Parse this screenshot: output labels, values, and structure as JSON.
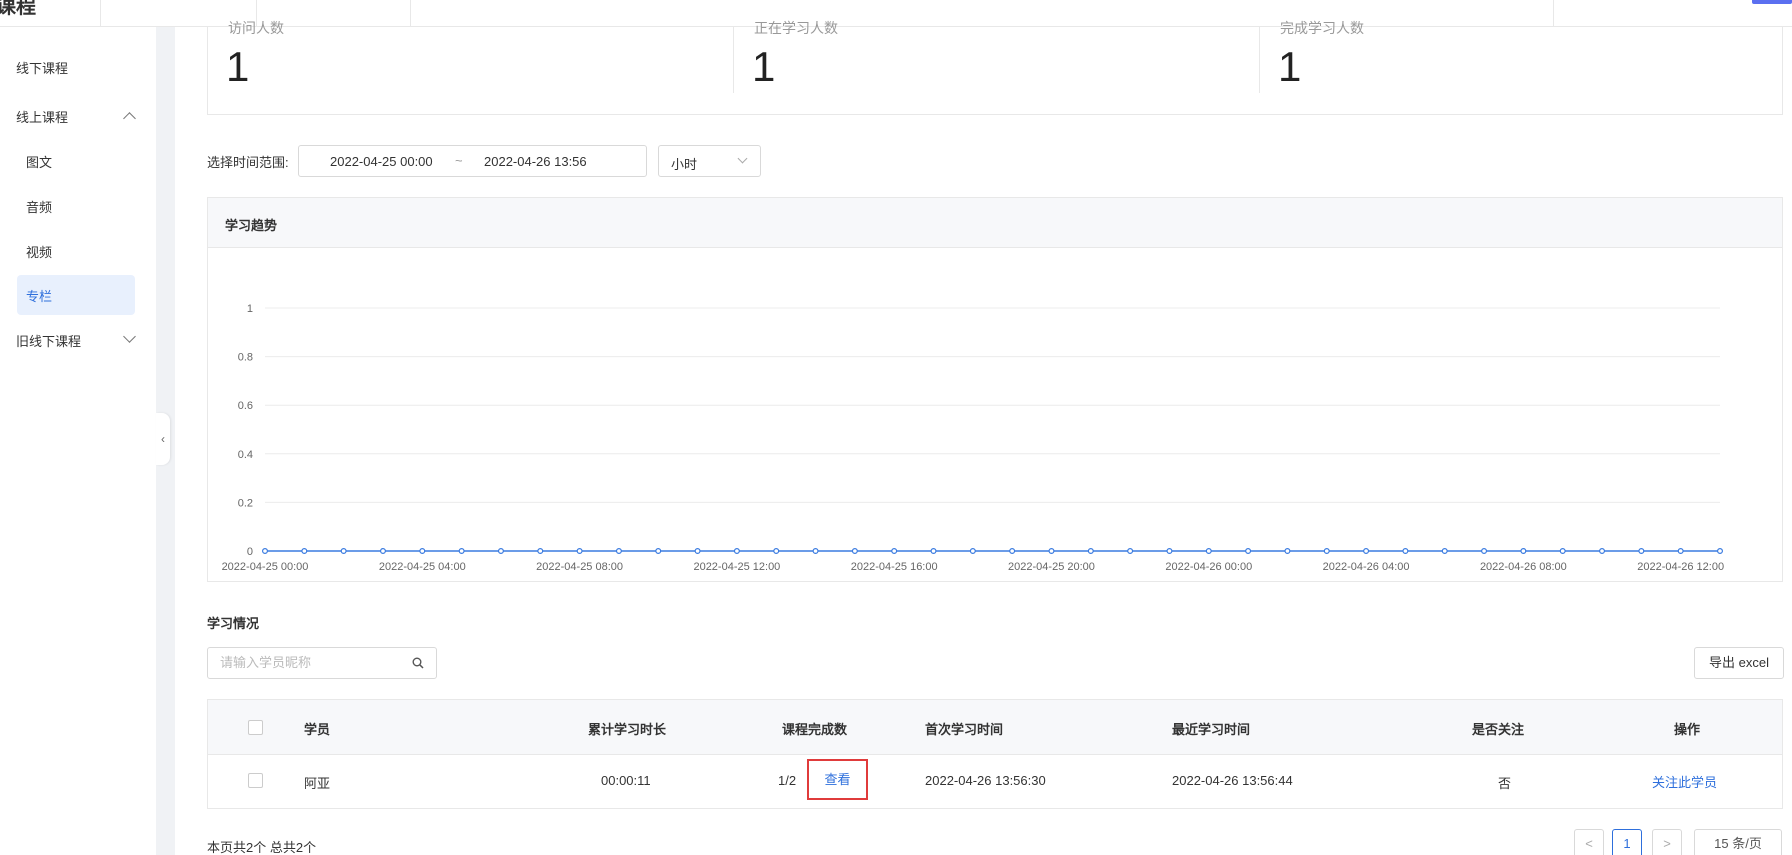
{
  "header": {
    "brand": "课程 "
  },
  "sidebar": {
    "items": [
      {
        "label": "线下课程"
      },
      {
        "label": "线上课程"
      },
      {
        "label": "旧线下课程"
      }
    ],
    "subitems": [
      {
        "label": "图文"
      },
      {
        "label": "音频"
      },
      {
        "label": "视频"
      },
      {
        "label": "专栏"
      }
    ]
  },
  "stats": [
    {
      "label": "访问人数",
      "value": "1"
    },
    {
      "label": "正在学习人数",
      "value": "1"
    },
    {
      "label": "完成学习人数",
      "value": "1"
    }
  ],
  "filter": {
    "label": "选择时间范围:",
    "start": "2022-04-25 00:00",
    "separator": "~",
    "end": "2022-04-26 13:56",
    "unit": "小时"
  },
  "chart_title": "学习趋势",
  "chart_data": {
    "type": "line",
    "x": [
      "2022-04-25 00:00",
      "2022-04-25 01:00",
      "2022-04-25 02:00",
      "2022-04-25 03:00",
      "2022-04-25 04:00",
      "2022-04-25 05:00",
      "2022-04-25 06:00",
      "2022-04-25 07:00",
      "2022-04-25 08:00",
      "2022-04-25 09:00",
      "2022-04-25 10:00",
      "2022-04-25 11:00",
      "2022-04-25 12:00",
      "2022-04-25 13:00",
      "2022-04-25 14:00",
      "2022-04-25 15:00",
      "2022-04-25 16:00",
      "2022-04-25 17:00",
      "2022-04-25 18:00",
      "2022-04-25 19:00",
      "2022-04-25 20:00",
      "2022-04-25 21:00",
      "2022-04-25 22:00",
      "2022-04-25 23:00",
      "2022-04-26 00:00",
      "2022-04-26 01:00",
      "2022-04-26 02:00",
      "2022-04-26 03:00",
      "2022-04-26 04:00",
      "2022-04-26 05:00",
      "2022-04-26 06:00",
      "2022-04-26 07:00",
      "2022-04-26 08:00",
      "2022-04-26 09:00",
      "2022-04-26 10:00",
      "2022-04-26 11:00",
      "2022-04-26 12:00",
      "2022-04-26 13:00"
    ],
    "x_tick_labels": [
      "2022-04-25 00:00",
      "2022-04-25 04:00",
      "2022-04-25 08:00",
      "2022-04-25 12:00",
      "2022-04-25 16:00",
      "2022-04-25 20:00",
      "2022-04-26 00:00",
      "2022-04-26 04:00",
      "2022-04-26 08:00",
      "2022-04-26 12:00"
    ],
    "y_ticks": [
      "0",
      "0.2",
      "0.4",
      "0.6",
      "0.8",
      "1"
    ],
    "series": [
      {
        "values": [
          0,
          0,
          0,
          0,
          0,
          0,
          0,
          0,
          0,
          0,
          0,
          0,
          0,
          0,
          0,
          0,
          0,
          0,
          0,
          0,
          0,
          0,
          0,
          0,
          0,
          0,
          0,
          0,
          0,
          0,
          0,
          0,
          0,
          0,
          0,
          0,
          0,
          0
        ]
      }
    ],
    "ylim": [
      0,
      1
    ],
    "grid": true,
    "color": "#3a7be0"
  },
  "study": {
    "title": "学习情况",
    "search_placeholder": "请输入学员昵称",
    "export_label": "导出 excel",
    "columns": [
      "学员",
      "累计学习时长",
      "课程完成数",
      "首次学习时间",
      "最近学习时间",
      "是否关注",
      "操作"
    ],
    "rows": [
      {
        "name": "阿亚",
        "duration": "00:00:11",
        "completed": "1/2",
        "view_label": "查看",
        "first_time": "2022-04-26 13:56:30",
        "last_time": "2022-04-26 13:56:44",
        "followed": "否",
        "action": "关注此学员"
      }
    ]
  },
  "pagination": {
    "summary": "本页共2个 总共2个",
    "prev": "<",
    "current": "1",
    "next": ">",
    "page_size": "15 条/页"
  }
}
